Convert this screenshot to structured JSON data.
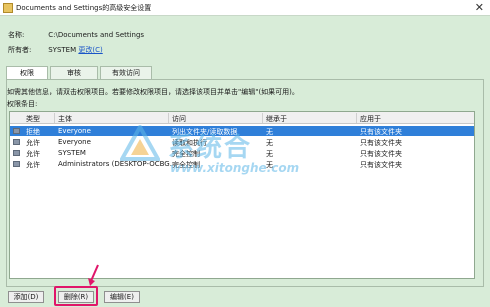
{
  "window": {
    "title": "Documents and Settings的高级安全设置",
    "close_glyph": "✕"
  },
  "info": {
    "name_label": "名称:",
    "name_value": "C:\\Documents and Settings",
    "owner_label": "所有者:",
    "owner_value": "SYSTEM",
    "owner_change_link": "更改(C)"
  },
  "tabs": [
    {
      "label": "权限"
    },
    {
      "label": "审核"
    },
    {
      "label": "有效访问"
    }
  ],
  "description": "如需其他信息，请双击权限项目。若要修改权限项目，请选择该项目并单击\"编辑\"(如果可用)。",
  "permissions_title": "权限条目:",
  "table": {
    "columns": [
      "类型",
      "主体",
      "访问",
      "继承于",
      "应用于"
    ],
    "rows": [
      {
        "type": "拒绝",
        "principal": "Everyone",
        "access": "列出文件夹/读取数据",
        "inherited": "无",
        "applies": "只有该文件夹"
      },
      {
        "type": "允许",
        "principal": "Everyone",
        "access": "读取和执行",
        "inherited": "无",
        "applies": "只有该文件夹"
      },
      {
        "type": "允许",
        "principal": "SYSTEM",
        "access": "完全控制",
        "inherited": "无",
        "applies": "只有该文件夹"
      },
      {
        "type": "允许",
        "principal": "Administrators (DESKTOP-OCBG...",
        "access": "完全控制",
        "inherited": "无",
        "applies": "只有该文件夹"
      }
    ]
  },
  "watermark": {
    "text_cn": "系统合",
    "url": "www.xitonghe.com"
  },
  "buttons": {
    "add": "添加(D)",
    "remove": "删除(R)",
    "edit": "编辑(E)"
  },
  "colors": {
    "background": "#d8ecd8",
    "selection": "#2f7fd9",
    "highlight": "#e0166a",
    "link": "#1a55c8"
  }
}
